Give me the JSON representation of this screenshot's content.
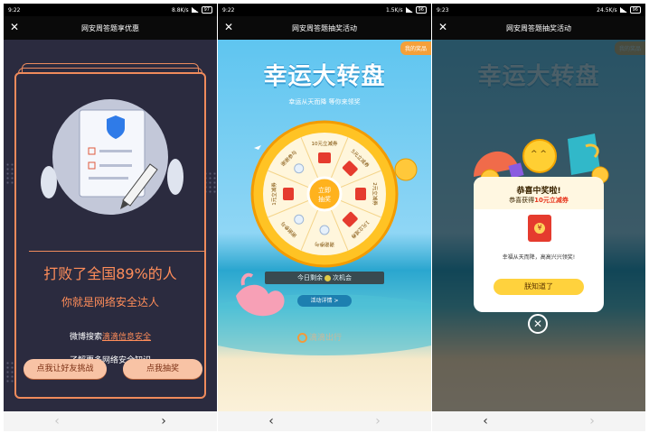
{
  "screens": [
    {
      "status": {
        "time": "9:22",
        "speed": "8.8K/s",
        "battery": "97"
      },
      "title": "网安周答题享优惠",
      "result_line1": "打败了全国89%的人",
      "result_line2": "你就是网络安全达人",
      "weibo_prefix": "微博搜索",
      "weibo_link": "滴滴信息安全",
      "learn_more": "了解更多网络安全知识",
      "btn_challenge": "点我让好友挑战",
      "btn_draw": "点我抽奖",
      "nav_back": "‹",
      "nav_forward": "›"
    },
    {
      "status": {
        "time": "9:22",
        "speed": "1.5K/s",
        "battery": "96"
      },
      "title": "网安周答题抽奖活动",
      "my_prize": "我的奖品",
      "big_title": "幸运大转盘",
      "subtitle": "幸运从天而降 等你来领奖",
      "center_btn": "立即抽奖",
      "wheel_labels": [
        "10元立减券",
        "5元立减券",
        "2元立减券",
        "1元立减券",
        "谢谢参与",
        "谢谢参与",
        "1元立减券",
        "谢谢参与"
      ],
      "chance_prefix": "今日剩余",
      "chance_suffix": "次机会",
      "detail_btn": "活动详情 >",
      "brand": "滴滴出行",
      "nav_back": "‹",
      "nav_forward": "›"
    },
    {
      "status": {
        "time": "9:23",
        "speed": "24.5K/s",
        "battery": "96"
      },
      "title": "网安周答题抽奖活动",
      "congrats": "恭喜中奖啦!",
      "got_prefix": "恭喜获得",
      "got_prize": "10元立减券",
      "note": "幸福从天而降，高高兴兴领奖!",
      "ok_btn": "朕知道了",
      "nav_back": "‹",
      "nav_forward": "›"
    }
  ],
  "colors": {
    "accent_orange": "#ef8b5c",
    "dark_bg": "#2b2b3f",
    "sky": "#5fc5f0",
    "gold": "#ffd23d"
  }
}
